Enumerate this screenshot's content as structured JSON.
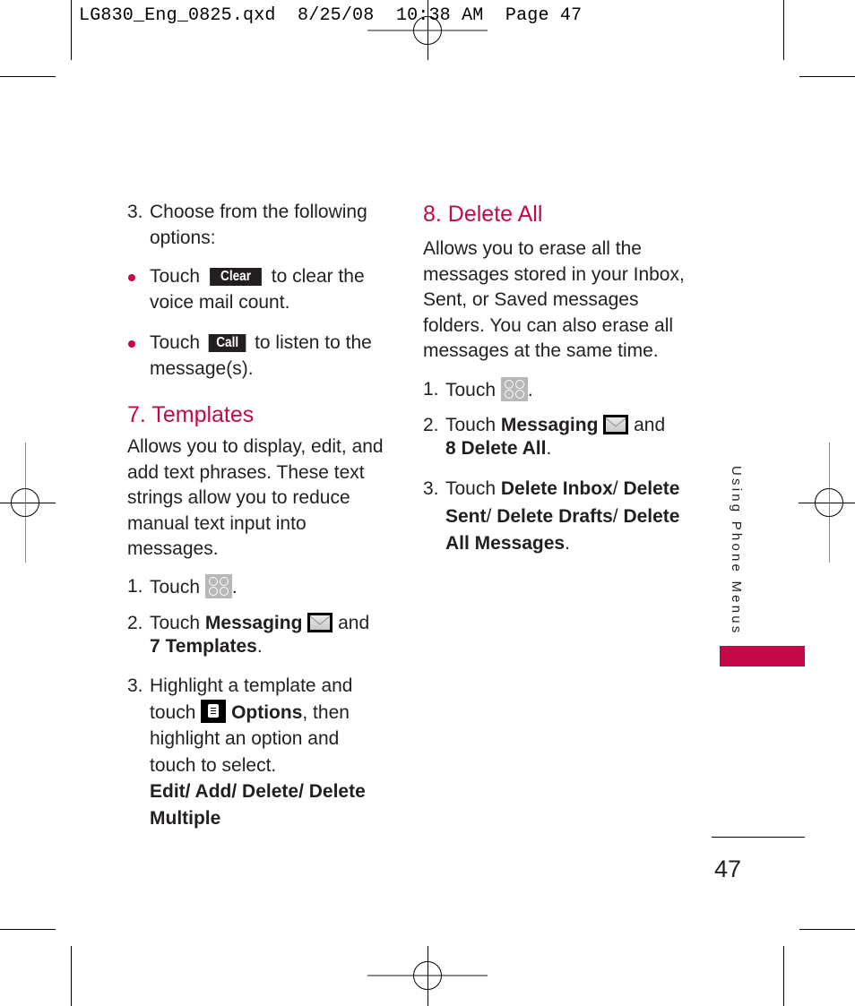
{
  "slug": {
    "filename": "LG830_Eng_0825.qxd",
    "date": "8/25/08",
    "time": "10:38 AM",
    "page_label": "Page 47"
  },
  "left_column": {
    "step3_num": "3.",
    "step3_text": "Choose from the following options:",
    "bullets": [
      {
        "prefix": "Touch",
        "key": "Clear",
        "suffix": "to clear the voice mail count."
      },
      {
        "prefix": "Touch",
        "key": "Call",
        "suffix": "to listen to the message(s)."
      }
    ],
    "templates": {
      "heading": "7. Templates",
      "description": "Allows you to display, edit, and add text phrases. These text strings allow you to reduce manual text input into messages.",
      "step1": {
        "num": "1.",
        "text": "Touch",
        "icon": "menu-grid-icon",
        "end": "."
      },
      "step2": {
        "num": "2.",
        "text": "Touch",
        "bold1": "Messaging",
        "icon": "envelope-icon",
        "and": "and",
        "bold2": "7 Templates",
        "end": "."
      },
      "step3": {
        "num": "3.",
        "text1": "Highlight a template and touch",
        "icon": "options-icon",
        "bold1": "Options",
        "text2": ", then highlight an option and touch to select.",
        "options": "Edit/ Add/ Delete/ Delete Multiple"
      }
    }
  },
  "right_column": {
    "delete_all": {
      "heading": "8. Delete All",
      "description": "Allows you to erase all the messages stored in your Inbox, Sent, or Saved messages folders. You can also erase all messages at the same time.",
      "step1": {
        "num": "1.",
        "text": "Touch",
        "icon": "menu-grid-icon",
        "end": "."
      },
      "step2": {
        "num": "2.",
        "text": "Touch",
        "bold1": "Messaging",
        "icon": "envelope-icon",
        "and": "and",
        "bold2": "8 Delete All",
        "end": "."
      },
      "step3": {
        "num": "3.",
        "text": "Touch",
        "b1": "Delete Inbox",
        "b2": "Delete Sent",
        "b3": "Delete Drafts",
        "b4": "Delete All Messages",
        "sep": "/",
        "end": "."
      }
    }
  },
  "sidebar": {
    "section_label": "Using Phone Menus",
    "accent_color": "#c4084a"
  },
  "footer": {
    "page_number": "47"
  }
}
